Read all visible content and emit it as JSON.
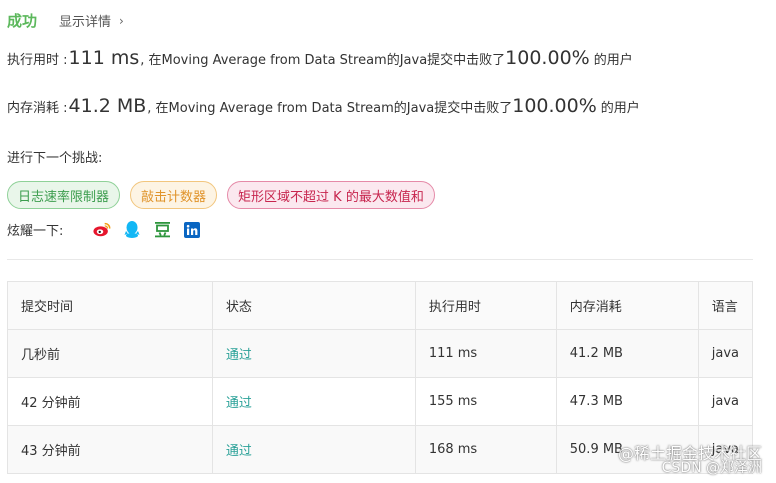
{
  "result": {
    "status": "成功",
    "details_link": "显示详情",
    "chevron": "›"
  },
  "runtime": {
    "label": "执行用时 :",
    "value": "111 ms",
    "middle": ", 在Moving Average from Data Stream的Java提交中击败了",
    "percent": "100.00%",
    "suffix": "的用户"
  },
  "memory": {
    "label": "内存消耗 :",
    "value": "41.2 MB",
    "middle": ", 在Moving Average from Data Stream的Java提交中击败了",
    "percent": "100.00%",
    "suffix": "的用户"
  },
  "next_challenge": {
    "label": "进行下一个挑战:",
    "tags": [
      {
        "label": "日志速率限制器",
        "level": "easy"
      },
      {
        "label": "敲击计数器",
        "level": "medium"
      },
      {
        "label": "矩形区域不超过 K 的最大数值和",
        "level": "hard"
      }
    ]
  },
  "share": {
    "label": "炫耀一下:",
    "icons": [
      "weibo-icon",
      "qq-icon",
      "douban-icon",
      "linkedin-icon"
    ],
    "colors": {
      "weibo": "#e6162d",
      "qq": "#12b7f5",
      "douban": "#2e963d",
      "linkedin": "#0a66c2"
    }
  },
  "table": {
    "headers": [
      "提交时间",
      "状态",
      "执行用时",
      "内存消耗",
      "语言"
    ],
    "rows": [
      [
        "几秒前",
        "通过",
        "111 ms",
        "41.2 MB",
        "java"
      ],
      [
        "42 分钟前",
        "通过",
        "155 ms",
        "47.3 MB",
        "java"
      ],
      [
        "43 分钟前",
        "通过",
        "168 ms",
        "50.9 MB",
        "java"
      ]
    ]
  },
  "watermark": {
    "line1": "@稀土掘金技术社区",
    "line2": "CSDN @郑泽洲"
  }
}
